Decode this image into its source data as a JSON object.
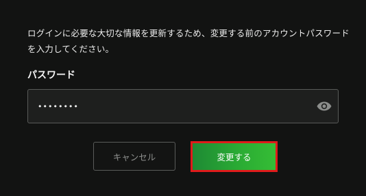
{
  "description": "ログインに必要な大切な情報を更新するため、変更する前のアカウントパスワードを入力してください。",
  "password_field": {
    "label": "パスワード",
    "value": "••••••••",
    "visibility_icon": "eye-icon"
  },
  "actions": {
    "cancel_label": "キャンセル",
    "submit_label": "変更する"
  },
  "colors": {
    "background": "#121312",
    "accent_green": "#2aab34",
    "highlight_border": "#e01b1b"
  }
}
